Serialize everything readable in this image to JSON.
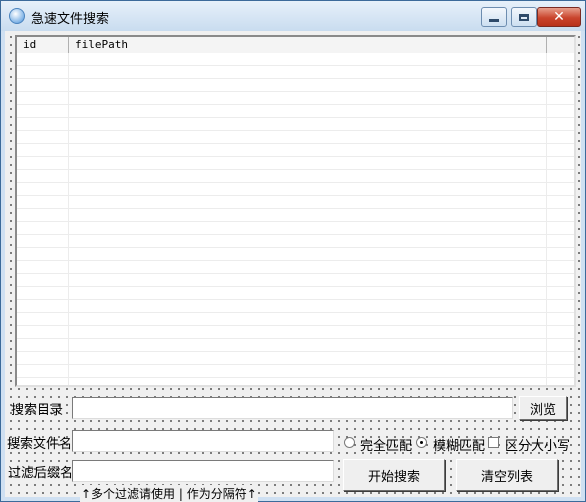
{
  "window": {
    "title": "急速文件搜索",
    "buttons": {
      "minimize": "minimize-icon",
      "maximize": "maximize-icon",
      "close": "close-icon"
    }
  },
  "list": {
    "columns": [
      "id",
      "filePath"
    ],
    "rows": []
  },
  "form": {
    "search_dir_label": "搜索目录",
    "search_dir_value": "",
    "browse_label": "浏览",
    "filename_label": "搜索文件名",
    "filename_value": "",
    "exact_match_label": "完全匹配",
    "fuzzy_match_label": "模糊匹配",
    "case_sensitive_label": "区分大小写",
    "selected_match_mode": "fuzzy",
    "case_sensitive": false,
    "filter_ext_label": "过滤后缀名",
    "filter_ext_value": "",
    "start_search_label": "开始搜索",
    "clear_list_label": "清空列表",
    "hint": "↑多个过滤请使用 | 作为分隔符↑"
  }
}
